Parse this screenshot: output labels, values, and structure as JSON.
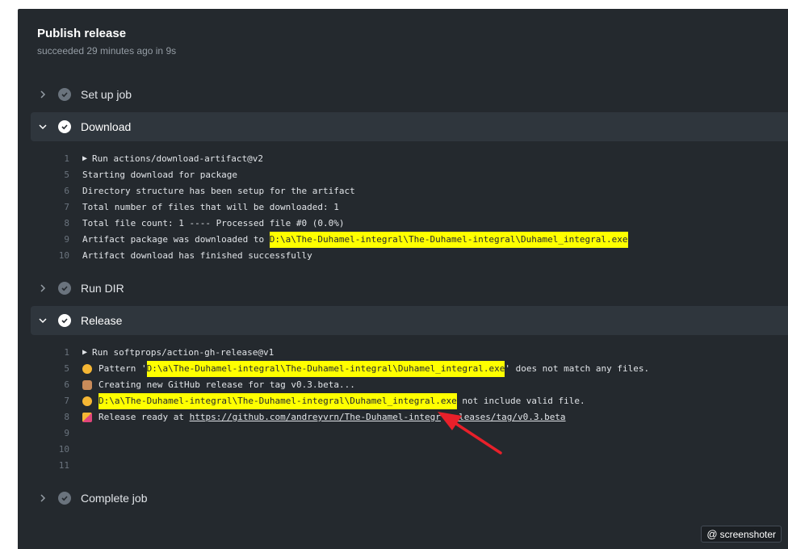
{
  "job": {
    "title": "Publish release",
    "status": "succeeded 29 minutes ago in 9s"
  },
  "steps": {
    "setup": {
      "label": "Set up job",
      "expanded": false
    },
    "download": {
      "label": "Download",
      "expanded": true
    },
    "rundir": {
      "label": "Run DIR",
      "expanded": false
    },
    "release": {
      "label": "Release",
      "expanded": true
    },
    "complete": {
      "label": "Complete job",
      "expanded": false
    }
  },
  "download_log": [
    {
      "n": "1",
      "text": "Run actions/download-artifact@v2"
    },
    {
      "n": "5",
      "text": "Starting download for package"
    },
    {
      "n": "6",
      "text": "Directory structure has been setup for the artifact"
    },
    {
      "n": "7",
      "text": "Total number of files that will be downloaded: 1"
    },
    {
      "n": "8",
      "text": "Total file count: 1 ---- Processed file #0 (0.0%)"
    },
    {
      "n": "9",
      "pre": "Artifact package was downloaded to ",
      "hl": "D:\\a\\The-Duhamel-integral\\The-Duhamel-integral\\Duhamel_integral.exe"
    },
    {
      "n": "10",
      "text": "Artifact download has finished successfully"
    }
  ],
  "release_log": [
    {
      "n": "1",
      "text": "Run softprops/action-gh-release@v1"
    },
    {
      "n": "5",
      "pre": "Pattern '",
      "hl": "D:\\a\\The-Duhamel-integral\\The-Duhamel-integral\\Duhamel_integral.exe",
      "post": "' does not match any files."
    },
    {
      "n": "6",
      "text": "Creating new GitHub release for tag v0.3.beta..."
    },
    {
      "n": "7",
      "hl": "D:\\a\\The-Duhamel-integral\\The-Duhamel-integral\\Duhamel_integral.exe",
      "post": " not include valid file."
    },
    {
      "n": "8",
      "pre": "Release ready at ",
      "link": "https://github.com/andreyvrn/The-Duhamel-integr",
      "link2": "releases/tag/v0.3.beta"
    },
    {
      "n": "9"
    },
    {
      "n": "10"
    },
    {
      "n": "11"
    }
  ],
  "watermark": "screenshoter",
  "colors": {
    "background": "#24292e",
    "expanded_step": "#2f363d",
    "highlight": "#ffff00",
    "annotation_arrow": "#e8202a"
  }
}
